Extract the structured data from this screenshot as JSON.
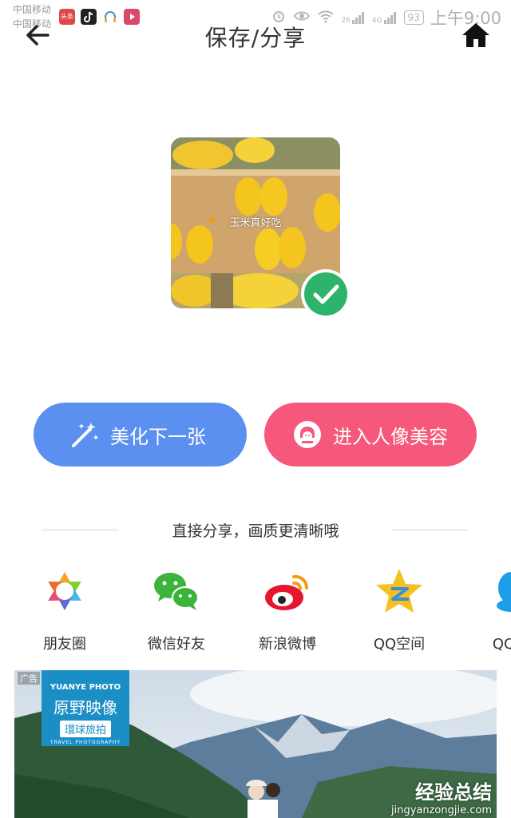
{
  "status_bar": {
    "carrier_1": "中国移动",
    "carrier_2": "中国移动",
    "apps": [
      "头条",
      "tiktok-icon",
      "headphones-icon",
      "video-icon"
    ],
    "signal_1": "26",
    "signal_2": "4G",
    "battery": "93",
    "time": "上午9:00"
  },
  "header": {
    "title": "保存/分享",
    "back_icon": "back-arrow-icon",
    "home_icon": "home-icon"
  },
  "photo": {
    "caption": "玉米真好吃",
    "badge_icon": "check-icon",
    "badge_color": "#2eb36b"
  },
  "actions": {
    "beautify_label": "美化下一张",
    "beautify_color": "#5b8ff0",
    "portrait_label": "进入人像美容",
    "portrait_color": "#f5587a"
  },
  "share": {
    "title": "直接分享，画质更清晰哦",
    "items": [
      {
        "label": "朋友圈",
        "icon": "moments-icon"
      },
      {
        "label": "微信好友",
        "icon": "wechat-icon"
      },
      {
        "label": "新浪微博",
        "icon": "weibo-icon"
      },
      {
        "label": "QQ空间",
        "icon": "qzone-icon"
      },
      {
        "label": "QQ好",
        "icon": "qq-icon"
      }
    ]
  },
  "ad": {
    "tag": "广告",
    "logo_en": "YUANYE PHOTO",
    "logo_cn": "原野映像",
    "logo_sub": "環球旅拍",
    "logo_en_sub": "TRAVEL PHOTOGRAPHY"
  },
  "watermark": {
    "main": "经验总结",
    "url": "jingyanzongjie.com"
  }
}
